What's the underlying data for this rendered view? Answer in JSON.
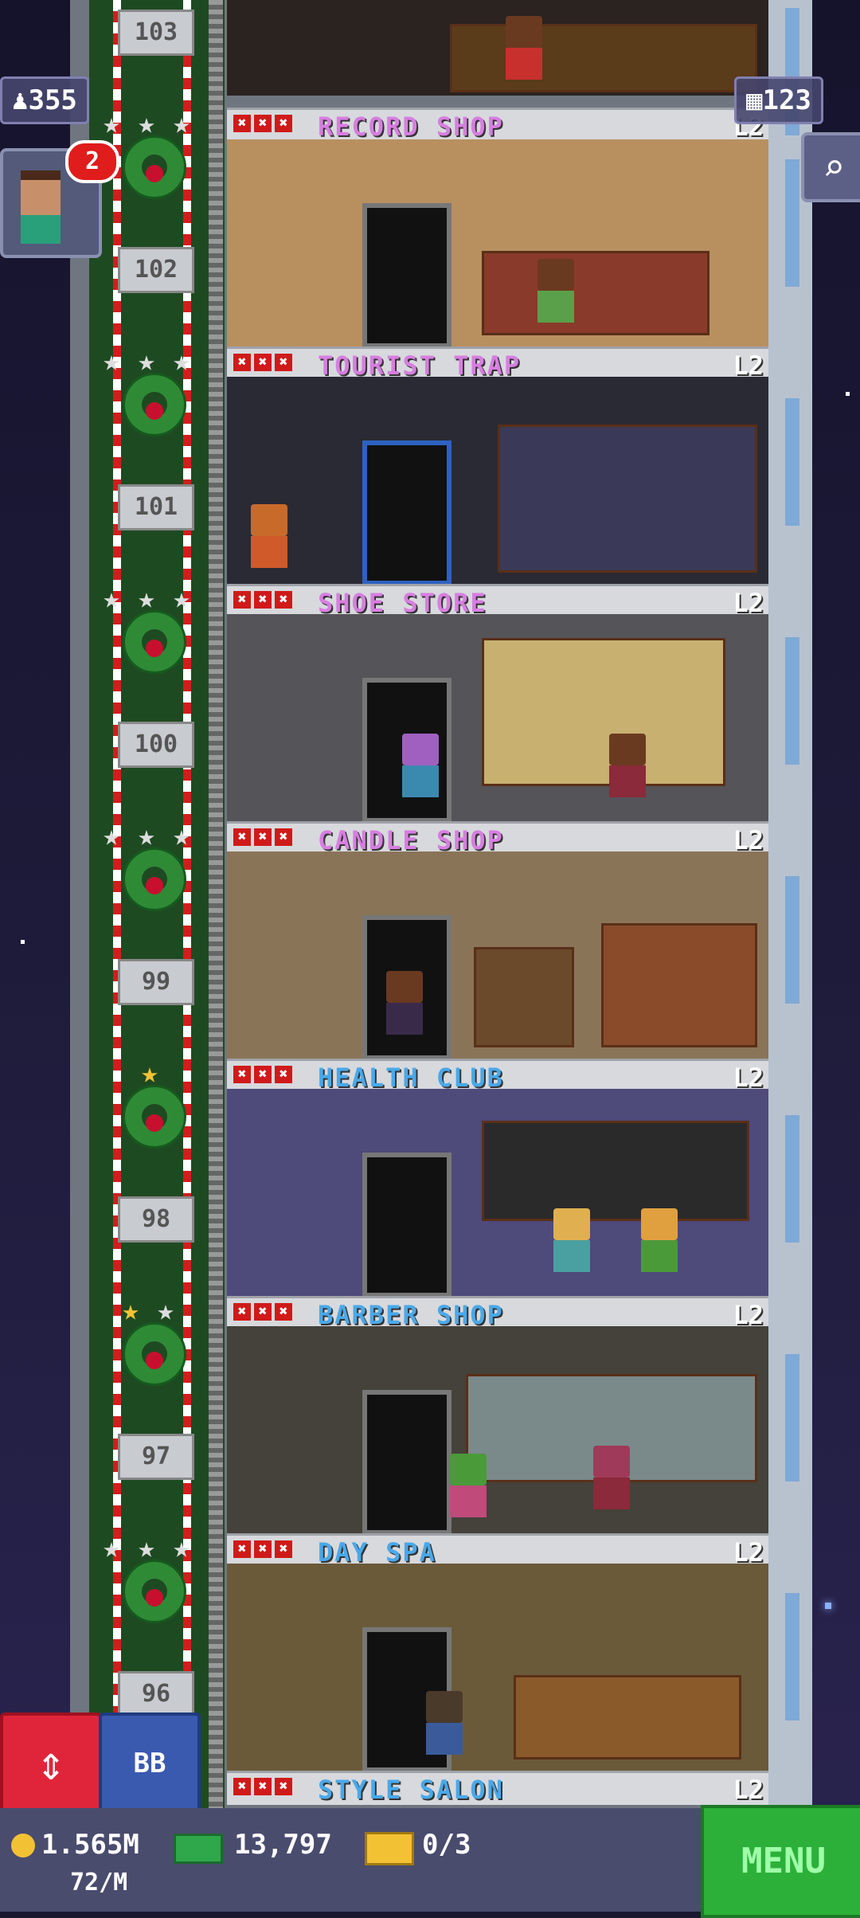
{
  "hud": {
    "population": "355",
    "floors": "123",
    "notifications": "2",
    "coins": "1.565M",
    "coin_rate": "72/M",
    "bux": "13,797",
    "tickets": "0/3",
    "bb_label": "BB",
    "menu_label": "MENU"
  },
  "elevator_floors": [
    "103",
    "102",
    "101",
    "100",
    "99",
    "98",
    "97",
    "96"
  ],
  "floors": [
    {
      "name": "RECORD SHOP",
      "level": "L2",
      "color": "#d77ee0"
    },
    {
      "name": "TOURIST TRAP",
      "level": "L2",
      "color": "#d77ee0"
    },
    {
      "name": "SHOE STORE",
      "level": "L2",
      "color": "#d77ee0"
    },
    {
      "name": "CANDLE SHOP",
      "level": "L2",
      "color": "#d77ee0"
    },
    {
      "name": "HEALTH CLUB",
      "level": "L2",
      "color": "#4aa8e8"
    },
    {
      "name": "BARBER SHOP",
      "level": "L2",
      "color": "#4aa8e8"
    },
    {
      "name": "DAY SPA",
      "level": "L2",
      "color": "#4aa8e8"
    },
    {
      "name": "STYLE SALON",
      "level": "L2",
      "color": "#4aa8e8"
    }
  ],
  "icons": {
    "population": "person-icon",
    "floors": "building-icon",
    "zoom": "magnifier-icon",
    "coins": "coin-icon",
    "bux": "bux-icon",
    "tickets": "ticket-icon",
    "elevator": "up-down-arrow-icon"
  }
}
